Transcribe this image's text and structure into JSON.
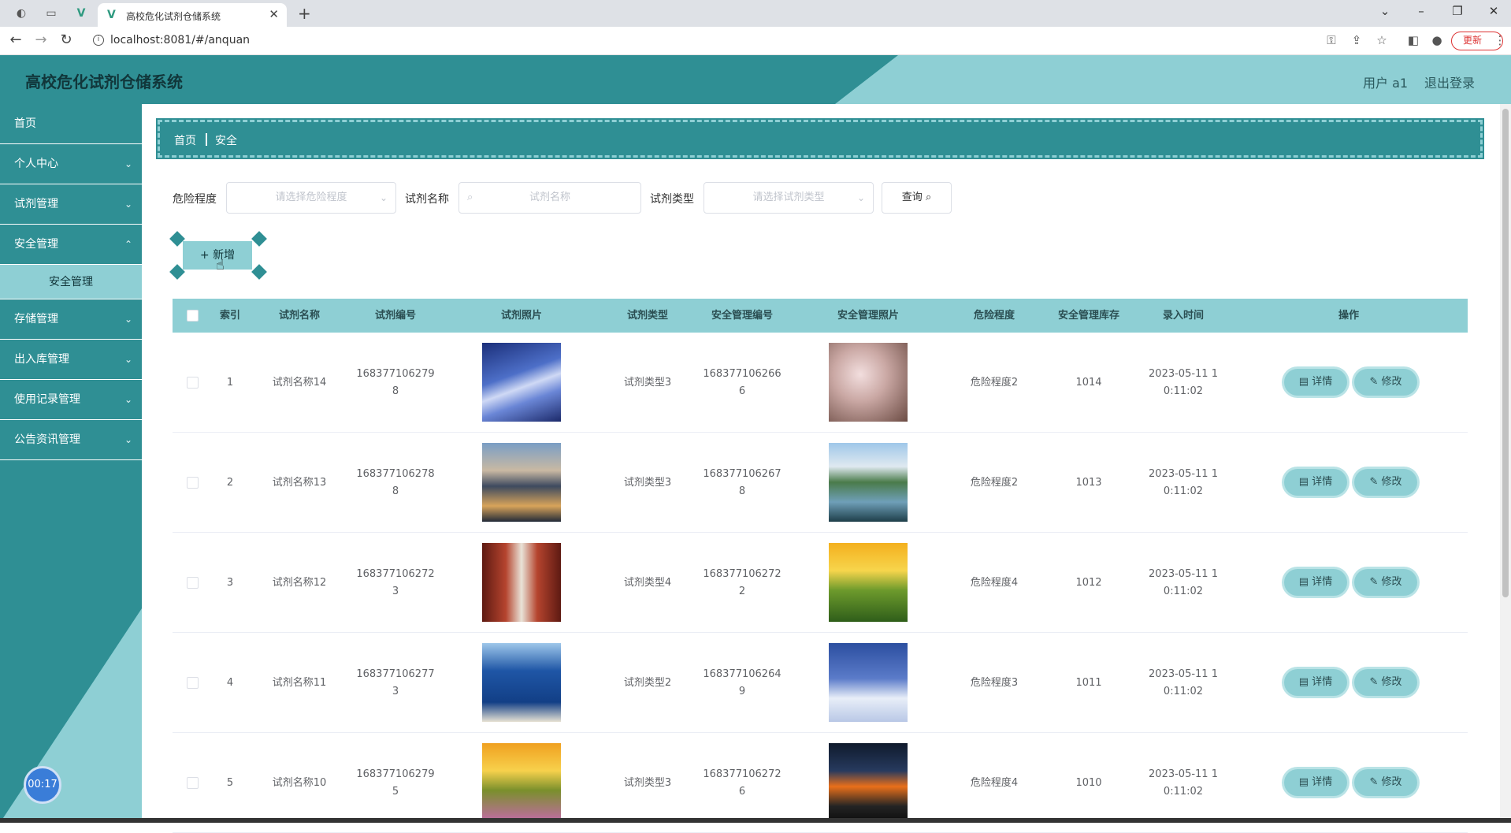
{
  "browser": {
    "tab_title": "高校危化试剂仓储系统",
    "url": "localhost:8081/#/anquan",
    "update_label": "更新"
  },
  "header": {
    "title": "高校危化试剂仓储系统",
    "user": "用户 a1",
    "logout": "退出登录"
  },
  "sidebar": {
    "items": [
      {
        "label": "首页",
        "has_children": false
      },
      {
        "label": "个人中心",
        "has_children": true
      },
      {
        "label": "试剂管理",
        "has_children": true
      },
      {
        "label": "安全管理",
        "has_children": true,
        "expanded": true
      },
      {
        "label": "存储管理",
        "has_children": true
      },
      {
        "label": "出入库管理",
        "has_children": true
      },
      {
        "label": "使用记录管理",
        "has_children": true
      },
      {
        "label": "公告资讯管理",
        "has_children": true
      }
    ],
    "active_sub": "安全管理",
    "timer": "00:17"
  },
  "breadcrumb": {
    "home": "首页",
    "current": "安全"
  },
  "search": {
    "danger_label": "危险程度",
    "danger_placeholder": "请选择危险程度",
    "name_label": "试剂名称",
    "name_placeholder": "试剂名称",
    "type_label": "试剂类型",
    "type_placeholder": "请选择试剂类型",
    "query_label": "查询"
  },
  "add_label": "新增",
  "table": {
    "headers": [
      "索引",
      "试剂名称",
      "试剂编号",
      "试剂照片",
      "试剂类型",
      "安全管理编号",
      "安全管理照片",
      "危险程度",
      "安全管理库存",
      "录入时间",
      "操作"
    ],
    "rows": [
      {
        "index": "1",
        "name": "试剂名称14",
        "code_l1": "1683771062798",
        "code_l2": "",
        "type": "试剂类型3",
        "safe_l1": "1683771062666",
        "safe_l2": "",
        "danger": "危险程度2",
        "stock": "1014",
        "time_l1": "2023-05-11 1",
        "time_l2": "0:11:02",
        "photo": "sky-clouds",
        "safe_photo": "blossom"
      },
      {
        "index": "2",
        "name": "试剂名称13",
        "code_l1": "1683771062788",
        "code_l2": "",
        "type": "试剂类型3",
        "safe_l1": "1683771062678",
        "safe_l2": "",
        "danger": "危险程度2",
        "stock": "1013",
        "time_l1": "2023-05-11 1",
        "time_l2": "0:11:02",
        "photo": "mountain-city",
        "safe_photo": "lake-hills"
      },
      {
        "index": "3",
        "name": "试剂名称12",
        "code_l1": "1683771062723",
        "code_l2": "",
        "type": "试剂类型4",
        "safe_l1": "1683771062722",
        "safe_l2": "",
        "danger": "危险程度4",
        "stock": "1012",
        "time_l1": "2023-05-11 1",
        "time_l2": "0:11:02",
        "photo": "red-corridor",
        "safe_photo": "sunrise-flowers"
      },
      {
        "index": "4",
        "name": "试剂名称11",
        "code_l1": "1683771062773",
        "code_l2": "",
        "type": "试剂类型2",
        "safe_l1": "1683771062649",
        "safe_l2": "",
        "danger": "危险程度3",
        "stock": "1011",
        "time_l1": "2023-05-11 1",
        "time_l2": "0:11:02",
        "photo": "sea-umbrella",
        "safe_photo": "snow-cabin"
      },
      {
        "index": "5",
        "name": "试剂名称10",
        "code_l1": "1683771062795",
        "code_l2": "",
        "type": "试剂类型3",
        "safe_l1": "1683771062726",
        "safe_l2": "",
        "danger": "危险程度4",
        "stock": "1010",
        "time_l1": "2023-05-11 1",
        "time_l2": "0:11:02",
        "photo": "sunset-meadow",
        "safe_photo": "sunset-road"
      }
    ],
    "detail_label": "详情",
    "edit_label": "修改"
  },
  "colors": {
    "primary": "#2f8f94",
    "light": "#8ecfd4"
  }
}
